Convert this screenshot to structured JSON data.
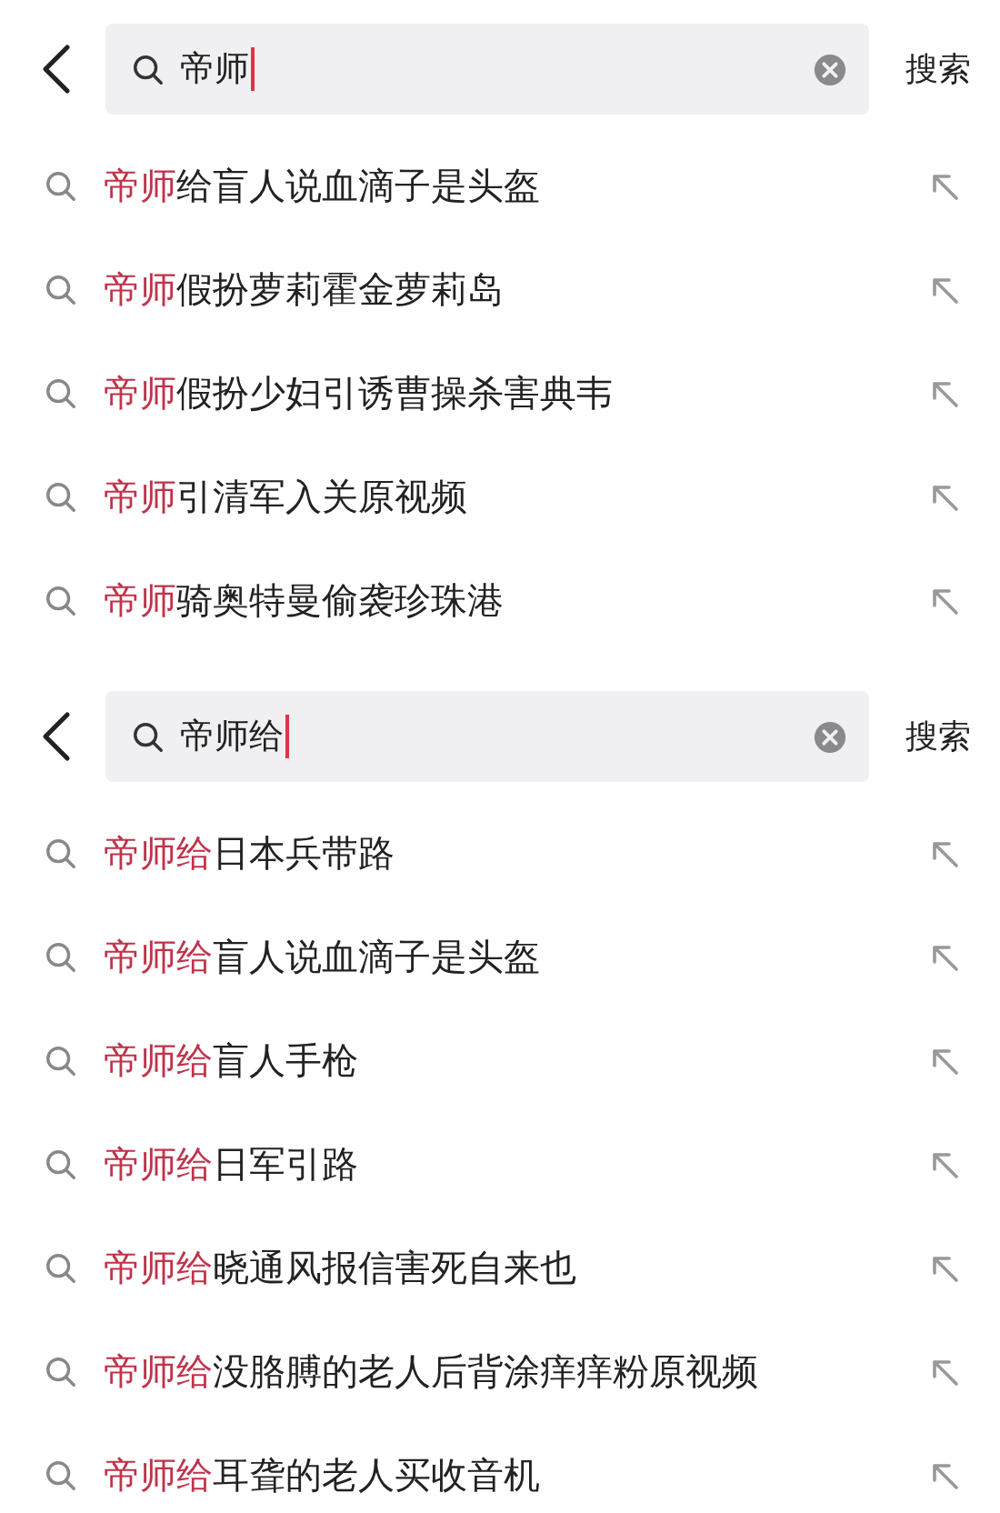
{
  "panels": [
    {
      "query": "帝师",
      "search_label": "搜索",
      "suggestions": [
        {
          "match": "帝师",
          "rest": "给盲人说血滴子是头盔"
        },
        {
          "match": "帝师",
          "rest": "假扮萝莉霍金萝莉岛"
        },
        {
          "match": "帝师",
          "rest": "假扮少妇引诱曹操杀害典韦"
        },
        {
          "match": "帝师",
          "rest": "引清军入关原视频"
        },
        {
          "match": "帝师",
          "rest": "骑奥特曼偷袭珍珠港"
        }
      ]
    },
    {
      "query": "帝师给",
      "search_label": "搜索",
      "suggestions": [
        {
          "match": "帝师给",
          "rest": "日本兵带路"
        },
        {
          "match": "帝师给",
          "rest": "盲人说血滴子是头盔"
        },
        {
          "match": "帝师给",
          "rest": "盲人手枪"
        },
        {
          "match": "帝师给",
          "rest": "日军引路"
        },
        {
          "match": "帝师给",
          "rest": "晓通风报信害死自来也"
        },
        {
          "match": "帝师给",
          "rest": "没胳膊的老人后背涂痒痒粉原视频"
        },
        {
          "match": "帝师给",
          "rest": "耳聋的老人买收音机"
        }
      ]
    }
  ]
}
